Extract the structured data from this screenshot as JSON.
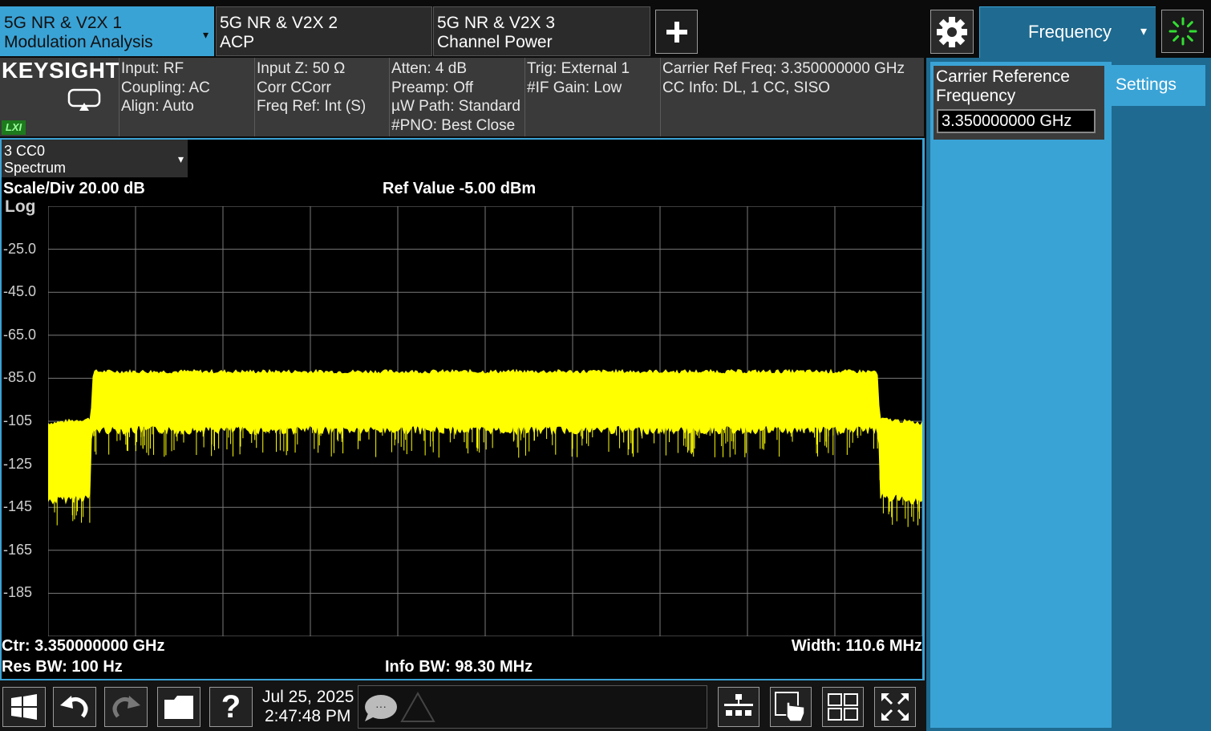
{
  "tabs": [
    {
      "line1": "5G NR & V2X 1",
      "line2": "Modulation Analysis",
      "caret": "▾"
    },
    {
      "line1": "5G NR & V2X 2",
      "line2": "ACP"
    },
    {
      "line1": "5G NR & V2X 3",
      "line2": "Channel Power"
    }
  ],
  "menu": {
    "label": "Frequency",
    "caret": "▾"
  },
  "brand": "KEYSIGHT",
  "lxi": "LXI",
  "info": {
    "col1": [
      "Input: RF",
      "Coupling: AC",
      "Align: Auto"
    ],
    "col2": [
      "Input Z: 50 Ω",
      "Corr CCorr",
      "Freq Ref: Int (S)"
    ],
    "col3": [
      "Atten: 4 dB",
      "Preamp: Off",
      "µW Path: Standard",
      "#PNO: Best Close"
    ],
    "col4": [
      "Trig: External 1",
      "#IF Gain: Low"
    ],
    "col5": [
      "Carrier Ref Freq: 3.350000000 GHz",
      "CC Info: DL, 1 CC, SISO"
    ]
  },
  "window": {
    "selector_line1": "3 CC0",
    "selector_line2": "Spectrum",
    "scale": "Scale/Div 20.00 dB",
    "ref": "Ref Value -5.00 dBm",
    "log": "Log",
    "center": "Ctr: 3.350000000 GHz",
    "resbw": "Res BW: 100 Hz",
    "infobw": "Info BW: 98.30 MHz",
    "width": "Width: 110.6 MHz"
  },
  "chart_data": {
    "type": "area",
    "trace_color": "#ffff00",
    "grid": true,
    "y_tick_labels": [
      "-25.0",
      "-45.0",
      "-65.0",
      "-85.0",
      "-105",
      "-125",
      "-145",
      "-165",
      "-185"
    ],
    "y_ticks": [
      -25,
      -45,
      -65,
      -85,
      -105,
      -125,
      -145,
      -165,
      -185
    ],
    "ylim": [
      -205,
      -5
    ],
    "xlim": [
      3294.7,
      3405.3
    ],
    "x_unit": "MHz",
    "trace_profile": {
      "x": [
        3294.7,
        3300.0,
        3300.2,
        3300.4,
        3399.6,
        3399.8,
        3400.0,
        3405.3
      ],
      "top": [
        -106,
        -104,
        -98,
        -82,
        -82,
        -98,
        -104,
        -106
      ],
      "bottom": [
        -140,
        -138,
        -110,
        -107,
        -107,
        -110,
        -138,
        -140
      ]
    }
  },
  "panel": {
    "field_label": "Carrier Reference Frequency",
    "field_value": "3.350000000 GHz",
    "settings": "Settings"
  },
  "bottom": {
    "date": "Jul 25, 2025",
    "time": "2:47:48 PM",
    "help": "?",
    "more": "···"
  }
}
